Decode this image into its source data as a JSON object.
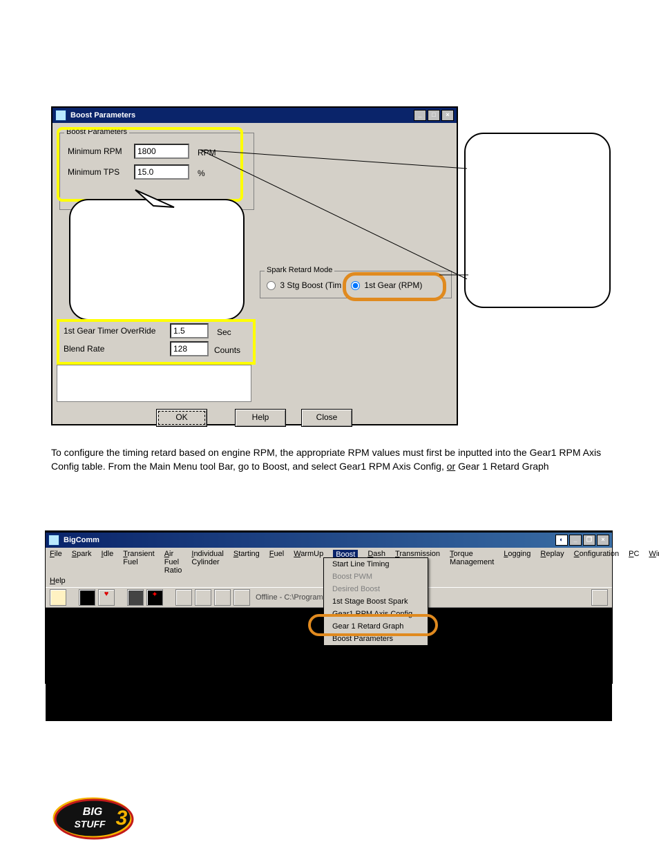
{
  "dialog": {
    "title": "Boost Parameters",
    "params_group_title": "Boost Parameters",
    "min_rpm_label": "Minimum RPM",
    "min_rpm_value": "1800",
    "min_rpm_unit": "RPM",
    "min_tps_label": "Minimum TPS",
    "min_tps_value": "15.0",
    "min_tps_unit": "%",
    "override_label": "1st Gear Timer OverRide",
    "override_value": "1.5",
    "override_unit": "Sec",
    "blend_label": "Blend Rate",
    "blend_value": "128",
    "blend_unit": "Counts",
    "sr_group_title": "Spark Retard Mode",
    "sr_opt1": "3 Stg Boost (Tim",
    "sr_opt2": "1st Gear (RPM)",
    "ok": "OK",
    "help": "Help",
    "close": "Close"
  },
  "body_text": {
    "mid1": "To configure the timing retard based on engine RPM, the appropriate RPM values must first be inputted into the Gear1 RPM Axis Config table. From the Main Menu tool Bar, go to Boost, and select Gear1 RPM Axis Config, ",
    "mid_or": "or",
    "mid2": " Gear 1 Retard Graph"
  },
  "bigcomm": {
    "title": "BigComm",
    "menus": [
      "File",
      "Spark",
      "Idle",
      "Transient Fuel",
      "Air Fuel Ratio",
      "Individual Cylinder",
      "Starting",
      "Fuel",
      "WarmUp",
      "Boost",
      "Dash",
      "Transmission",
      "Torque Management",
      "Logging",
      "Replay",
      "Configuration",
      "PC",
      "Windows",
      "Help"
    ],
    "offline_path": "Offline - C:\\Program Files\\BigStuf…",
    "dropdown": {
      "items": [
        {
          "label": "Start Line Timing",
          "dis": false
        },
        {
          "label": "Boost PWM",
          "dis": true
        },
        {
          "label": "Desired Boost",
          "dis": true
        },
        {
          "label": "1st Stage Boost Spark",
          "dis": false
        },
        {
          "label": "Gear1 RPM Axis Config",
          "dis": false
        },
        {
          "label": "Gear 1 Retard Graph",
          "dis": false
        },
        {
          "label": "Boost Parameters",
          "dis": false
        }
      ]
    }
  }
}
